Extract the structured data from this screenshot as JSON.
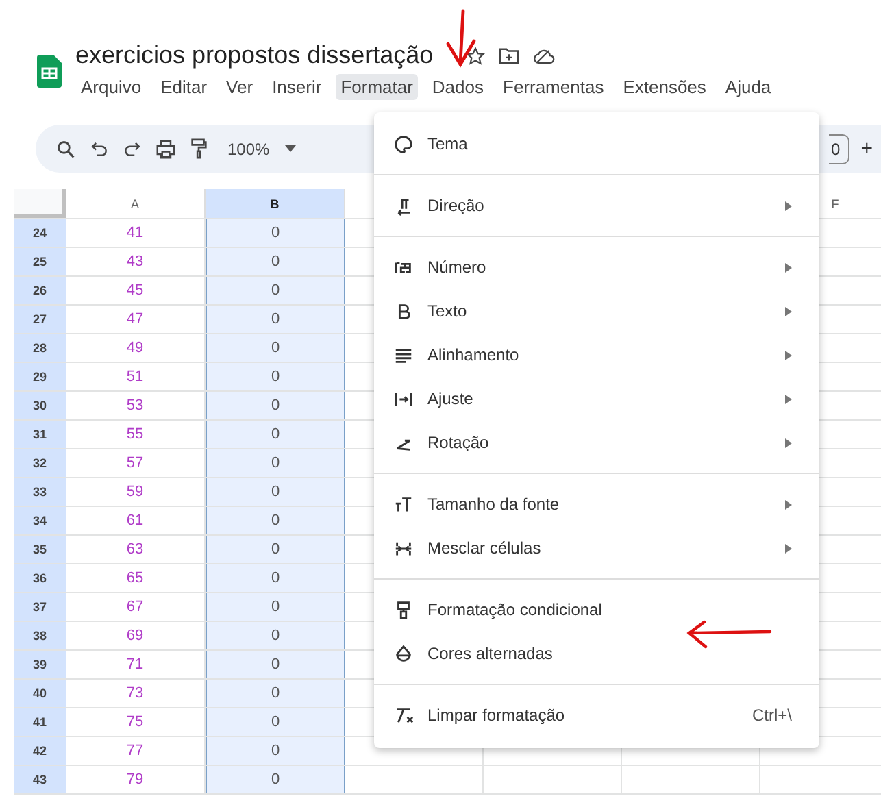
{
  "document": {
    "title": "exercicios propostos dissertação"
  },
  "menu_bar": [
    {
      "label": "Arquivo",
      "selected": false
    },
    {
      "label": "Editar",
      "selected": false
    },
    {
      "label": "Ver",
      "selected": false
    },
    {
      "label": "Inserir",
      "selected": false
    },
    {
      "label": "Formatar",
      "selected": true
    },
    {
      "label": "Dados",
      "selected": false
    },
    {
      "label": "Ferramentas",
      "selected": false
    },
    {
      "label": "Extensões",
      "selected": false
    },
    {
      "label": "Ajuda",
      "selected": false
    }
  ],
  "toolbar": {
    "zoom": "100%",
    "font_size": "0",
    "plus": "+"
  },
  "grid": {
    "columns": [
      {
        "label": "A",
        "selected": false
      },
      {
        "label": "B",
        "selected": true
      },
      {
        "label": "F",
        "selected": false
      }
    ],
    "rows": [
      {
        "number": "24",
        "a": "41",
        "b": "0"
      },
      {
        "number": "25",
        "a": "43",
        "b": "0"
      },
      {
        "number": "26",
        "a": "45",
        "b": "0"
      },
      {
        "number": "27",
        "a": "47",
        "b": "0"
      },
      {
        "number": "28",
        "a": "49",
        "b": "0"
      },
      {
        "number": "29",
        "a": "51",
        "b": "0"
      },
      {
        "number": "30",
        "a": "53",
        "b": "0"
      },
      {
        "number": "31",
        "a": "55",
        "b": "0"
      },
      {
        "number": "32",
        "a": "57",
        "b": "0"
      },
      {
        "number": "33",
        "a": "59",
        "b": "0"
      },
      {
        "number": "34",
        "a": "61",
        "b": "0"
      },
      {
        "number": "35",
        "a": "63",
        "b": "0"
      },
      {
        "number": "36",
        "a": "65",
        "b": "0"
      },
      {
        "number": "37",
        "a": "67",
        "b": "0"
      },
      {
        "number": "38",
        "a": "69",
        "b": "0"
      },
      {
        "number": "39",
        "a": "71",
        "b": "0"
      },
      {
        "number": "40",
        "a": "73",
        "b": "0"
      },
      {
        "number": "41",
        "a": "75",
        "b": "0"
      },
      {
        "number": "42",
        "a": "77",
        "b": "0"
      },
      {
        "number": "43",
        "a": "79",
        "b": "0"
      }
    ]
  },
  "format_menu": [
    {
      "kind": "item",
      "label": "Tema",
      "submenu": false
    },
    {
      "kind": "separator"
    },
    {
      "kind": "item",
      "label": "Direção",
      "submenu": true
    },
    {
      "kind": "separator"
    },
    {
      "kind": "item",
      "label": "Número",
      "submenu": true
    },
    {
      "kind": "item",
      "label": "Texto",
      "submenu": true
    },
    {
      "kind": "item",
      "label": "Alinhamento",
      "submenu": true
    },
    {
      "kind": "item",
      "label": "Ajuste",
      "submenu": true
    },
    {
      "kind": "item",
      "label": "Rotação",
      "submenu": true
    },
    {
      "kind": "separator"
    },
    {
      "kind": "item",
      "label": "Tamanho da fonte",
      "submenu": true
    },
    {
      "kind": "item",
      "label": "Mesclar células",
      "submenu": true
    },
    {
      "kind": "separator"
    },
    {
      "kind": "item",
      "label": "Formatação condicional",
      "submenu": false
    },
    {
      "kind": "item",
      "label": "Cores alternadas",
      "submenu": false
    },
    {
      "kind": "separator"
    },
    {
      "kind": "item",
      "label": "Limpar formatação",
      "submenu": false,
      "shortcut": "Ctrl+\\"
    }
  ]
}
